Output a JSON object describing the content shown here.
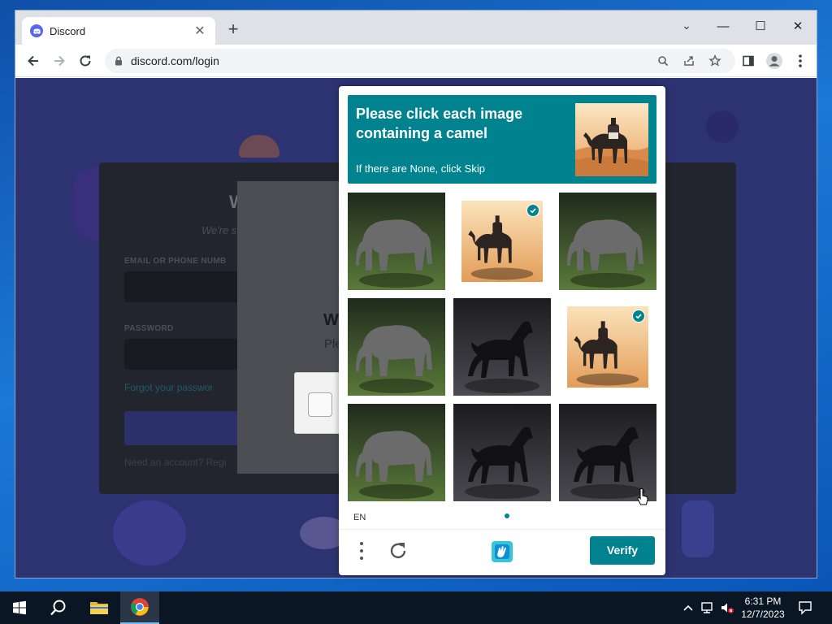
{
  "browser": {
    "tab_title": "Discord",
    "tab_close": "✕",
    "new_tab": "+",
    "url": "discord.com/login",
    "window_controls": {
      "tab_search": "⌄",
      "minimize": "—",
      "maximize": "☐",
      "close": "✕"
    }
  },
  "login": {
    "heading": "W",
    "subheading": "We're s",
    "email_label": "EMAIL OR PHONE NUMB",
    "password_label": "PASSWORD",
    "forgot_link": "Forgot your passwor",
    "register_text": "Need an account? Regi"
  },
  "overlay": {
    "title": "W",
    "subtitle": "Ple"
  },
  "captcha": {
    "prompt": "Please click each image containing a camel",
    "hint": "If there are None, click Skip",
    "language": "EN",
    "verify_label": "Verify",
    "accent_color": "#00838f",
    "tiles": [
      {
        "subject": "elephant",
        "selected": false
      },
      {
        "subject": "camel",
        "selected": true
      },
      {
        "subject": "elephant",
        "selected": false
      },
      {
        "subject": "elephant",
        "selected": false
      },
      {
        "subject": "horse",
        "selected": false
      },
      {
        "subject": "camel",
        "selected": true
      },
      {
        "subject": "elephant",
        "selected": false
      },
      {
        "subject": "horse",
        "selected": false
      },
      {
        "subject": "horse",
        "selected": false
      }
    ]
  },
  "taskbar": {
    "time": "6:31 PM",
    "date": "12/7/2023"
  }
}
